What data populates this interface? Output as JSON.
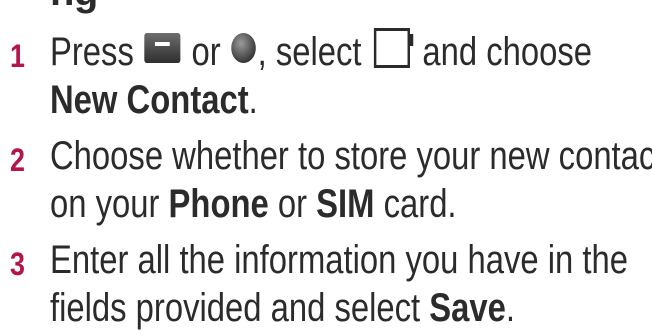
{
  "heading": "ng",
  "steps": [
    {
      "number": "1",
      "line1": {
        "press": "Press",
        "or": "or",
        "select": ", select",
        "choose": "and choose"
      },
      "line2": {
        "bold": "New Contact",
        "end": "."
      }
    },
    {
      "number": "2",
      "line1": {
        "text": "Choose whether to store your new contact"
      },
      "line2": {
        "pre": "on your",
        "bold1": "Phone",
        "or": "or",
        "bold2": "SIM",
        "end": "card."
      }
    },
    {
      "number": "3",
      "line1": {
        "text": "Enter all the information you have in the"
      },
      "line2": {
        "pre": "fields provided and select",
        "bold": "Save",
        "end": "."
      }
    }
  ],
  "icons": [
    "softkey-icon",
    "ok-key-icon",
    "contacts-icon"
  ],
  "colors": {
    "step_number": "#b5144a",
    "text": "#2b2b2b"
  }
}
